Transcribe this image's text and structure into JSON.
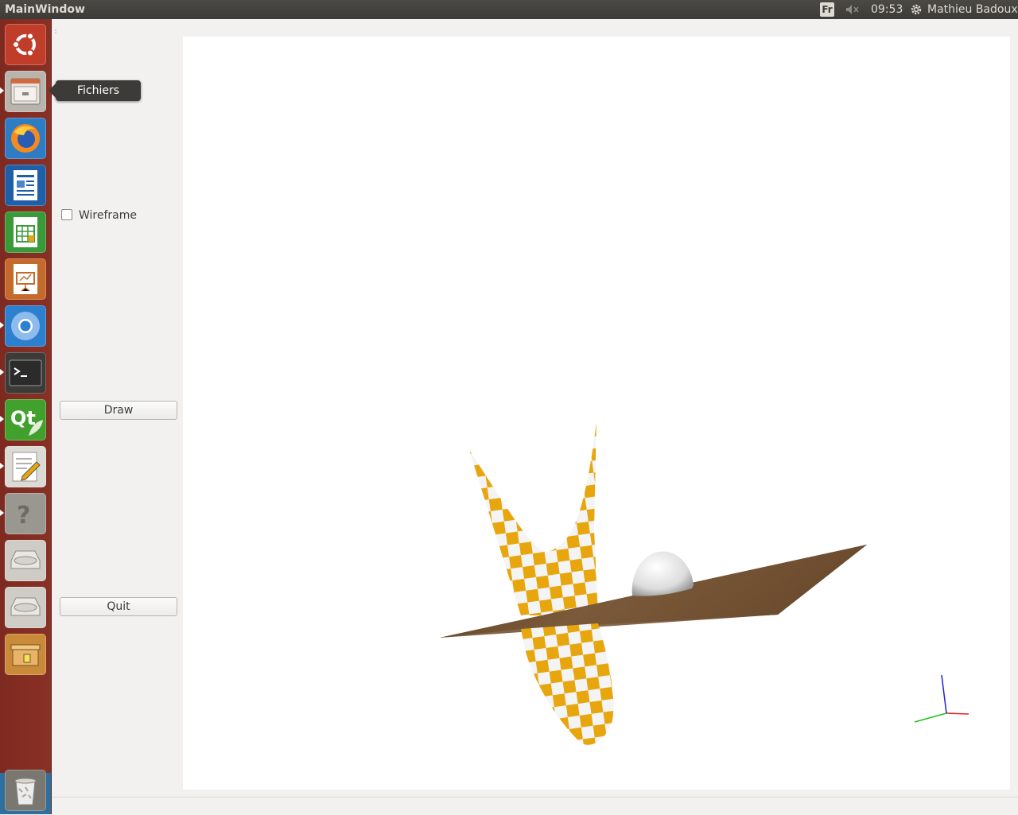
{
  "topbar": {
    "window_title": "MainWindow",
    "keyboard_layout": "Fr",
    "time": "09:53",
    "user_name": "Mathieu Badoux",
    "volume_icon": "volume-muted-icon",
    "settings_icon": "gear-icon"
  },
  "launcher": {
    "items": [
      {
        "name": "ubuntu-dash",
        "icon": "ubuntu-logo-icon"
      },
      {
        "name": "Fichiers",
        "icon": "file-cabinet-icon"
      },
      {
        "name": "firefox",
        "icon": "firefox-icon"
      },
      {
        "name": "libreoffice-writer",
        "icon": "writer-document-icon"
      },
      {
        "name": "libreoffice-calc",
        "icon": "calc-spreadsheet-icon"
      },
      {
        "name": "libreoffice-impress",
        "icon": "impress-presentation-icon"
      },
      {
        "name": "chromium",
        "icon": "chromium-icon"
      },
      {
        "name": "terminal",
        "icon": "terminal-icon"
      },
      {
        "name": "qt-creator",
        "icon": "qt-icon"
      },
      {
        "name": "text-editor",
        "icon": "text-editor-icon"
      },
      {
        "name": "help",
        "icon": "help-icon"
      },
      {
        "name": "drive-1",
        "icon": "hard-drive-icon"
      },
      {
        "name": "drive-2",
        "icon": "hard-drive-icon"
      },
      {
        "name": "archive",
        "icon": "archive-box-icon"
      },
      {
        "name": "trash",
        "icon": "trash-icon"
      }
    ],
    "tooltip": "Fichiers"
  },
  "controls": {
    "wireframe_label": "Wireframe",
    "wireframe_checked": false,
    "draw_label": "Draw",
    "quit_label": "Quit"
  },
  "scene": {
    "objects": [
      "checkered-parabolic-surface",
      "wooden-plane",
      "white-hemisphere",
      "axis-gizmo"
    ],
    "colors": {
      "checker_a": "#e8a60e",
      "checker_b": "#f4f4f4",
      "plane": "#6b4a2a",
      "axis_x": "#e02020",
      "axis_y": "#20c020",
      "axis_z": "#2020d0"
    }
  }
}
